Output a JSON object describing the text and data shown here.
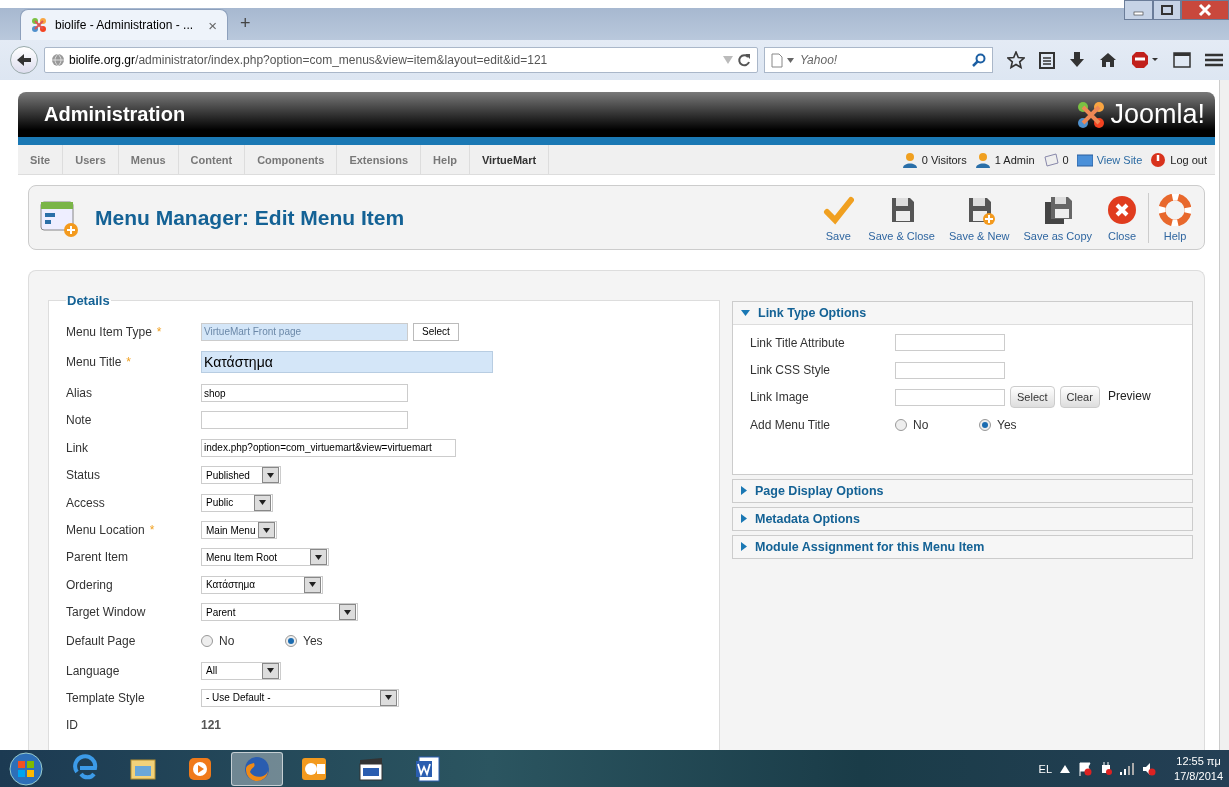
{
  "browser": {
    "tab_title": "biolife - Administration - ...",
    "tab_close": "×",
    "new_tab": "+",
    "url_host": "biolife.org.gr",
    "url_path": "/administrator/index.php?option=com_menus&view=item&layout=edit&id=121",
    "search_placeholder": "Yahoo!"
  },
  "header": {
    "title": "Administration",
    "logo_text": "Joomla!"
  },
  "menu": [
    {
      "label": "Site",
      "selected": false
    },
    {
      "label": "Users",
      "selected": false
    },
    {
      "label": "Menus",
      "selected": false
    },
    {
      "label": "Content",
      "selected": false
    },
    {
      "label": "Components",
      "selected": false
    },
    {
      "label": "Extensions",
      "selected": false
    },
    {
      "label": "Help",
      "selected": false
    },
    {
      "label": "VirtueMart",
      "selected": true
    }
  ],
  "status": [
    {
      "kind": "visitors",
      "label": "0 Visitors"
    },
    {
      "kind": "admin",
      "label": "1 Admin"
    },
    {
      "kind": "messages",
      "label": "0"
    },
    {
      "kind": "view_site",
      "label": "View Site"
    },
    {
      "kind": "logout",
      "label": "Log out"
    }
  ],
  "page_title": "Menu Manager: Edit Menu Item",
  "toolbar": [
    {
      "kind": "save",
      "label": "Save"
    },
    {
      "kind": "save_close",
      "label": "Save & Close"
    },
    {
      "kind": "save_new",
      "label": "Save & New"
    },
    {
      "kind": "save_copy",
      "label": "Save as Copy"
    },
    {
      "kind": "close",
      "label": "Close"
    },
    {
      "kind": "help",
      "label": "Help"
    }
  ],
  "details": {
    "legend": "Details",
    "fields": [
      {
        "kind": "readonly",
        "label": "Menu Item Type",
        "marker": "*",
        "value": "VirtueMart Front page",
        "button": "Select"
      },
      {
        "kind": "title",
        "label": "Menu Title",
        "marker": "*",
        "value": "Κατάστημα"
      },
      {
        "kind": "text",
        "label": "Alias",
        "value": "shop"
      },
      {
        "kind": "text",
        "label": "Note"
      },
      {
        "kind": "link",
        "label": "Link",
        "value": "index.php?option=com_virtuemart&view=virtuemart"
      },
      {
        "kind": "select",
        "label": "Status",
        "value": "Published"
      },
      {
        "kind": "select",
        "label": "Access",
        "value": "Public"
      },
      {
        "kind": "select",
        "label": "Menu Location",
        "marker": "*",
        "value": "Main Menu"
      },
      {
        "kind": "select",
        "label": "Parent Item",
        "value": "Menu Item Root"
      },
      {
        "kind": "select",
        "label": "Ordering",
        "value": "Κατάστημα"
      },
      {
        "kind": "select",
        "label": "Target Window",
        "value": "Parent"
      },
      {
        "kind": "radio",
        "label": "Default Page",
        "options": [
          {
            "label": "No",
            "selected": false
          },
          {
            "label": "Yes",
            "selected": true
          }
        ]
      },
      {
        "kind": "select",
        "label": "Language",
        "value": "All"
      },
      {
        "kind": "select",
        "label": "Template Style",
        "value": "- Use Default -"
      },
      {
        "kind": "static",
        "label": "ID",
        "value": "121"
      }
    ]
  },
  "panels": [
    {
      "title": "Link Type Options",
      "expanded": true,
      "fields": [
        {
          "kind": "text",
          "label": "Link Title Attribute"
        },
        {
          "kind": "text",
          "label": "Link CSS Style"
        },
        {
          "kind": "image",
          "label": "Link Image",
          "buttons": [
            "Select",
            "Clear"
          ],
          "preview": "Preview"
        },
        {
          "kind": "radio",
          "label": "Add Menu Title",
          "options": [
            {
              "label": "No",
              "selected": false
            },
            {
              "label": "Yes",
              "selected": true
            }
          ]
        }
      ]
    },
    {
      "title": "Page Display Options",
      "expanded": false
    },
    {
      "title": "Metadata Options",
      "expanded": false
    },
    {
      "title": "Module Assignment for this Menu Item",
      "expanded": false
    }
  ],
  "taskbar": {
    "apps": [
      {
        "kind": "ie",
        "selected": false
      },
      {
        "kind": "explorer",
        "selected": false
      },
      {
        "kind": "media",
        "selected": false
      },
      {
        "kind": "firefox",
        "selected": true
      },
      {
        "kind": "outlook",
        "selected": false
      },
      {
        "kind": "mpc",
        "selected": false
      },
      {
        "kind": "word",
        "selected": false
      }
    ],
    "language": "EL",
    "time": "12:55 πμ",
    "date": "17/8/2014"
  }
}
